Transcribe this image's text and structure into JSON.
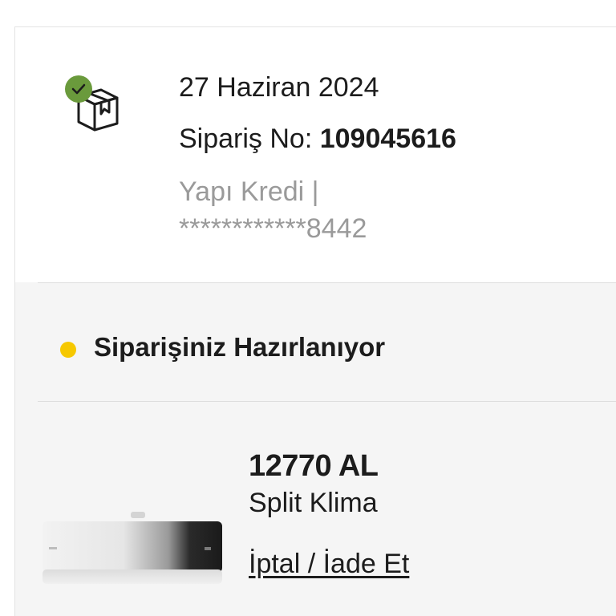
{
  "order": {
    "date": "27 Haziran 2024",
    "order_no_label": "Sipariş No:",
    "order_no_value": "109045616",
    "payment_bank": "Yapı Kredi |",
    "payment_card": "************8442",
    "status_color": "#f6c800",
    "status_text": "Siparişiniz Hazırlanıyor",
    "icon": "package-check-icon"
  },
  "product": {
    "price": "12770 AL",
    "name": "Split Klima",
    "cancel_label": "İptal / İade Et",
    "image": "air-conditioner-image"
  },
  "colors": {
    "check_badge": "#6a9a3c",
    "muted_text": "#9a9a9a",
    "gray_background": "#f5f5f5"
  }
}
